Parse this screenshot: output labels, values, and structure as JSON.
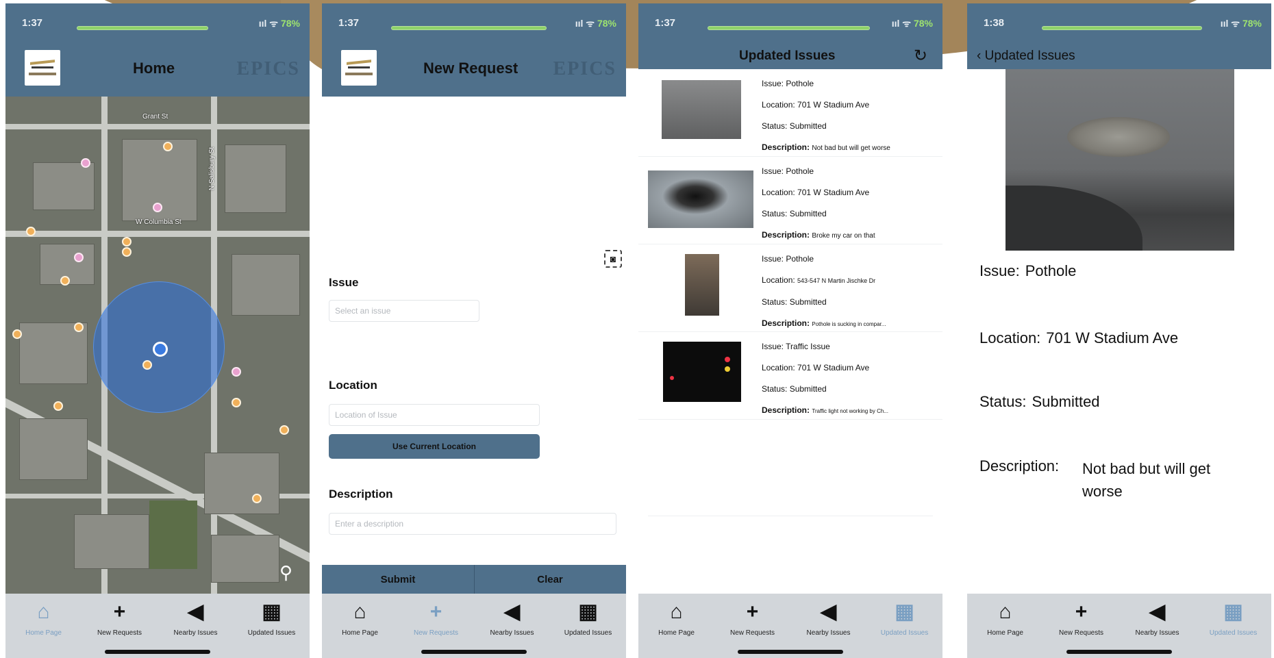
{
  "status": {
    "time_1": "1:37",
    "time_2": "1:37",
    "time_3": "1:37",
    "time_4": "1:38",
    "signal": "ııl ᯤ",
    "battery": "78%"
  },
  "brand": {
    "epics": "EPICS"
  },
  "screens": {
    "home": {
      "title": "Home"
    },
    "new_request": {
      "title": "New Request",
      "issue_label": "Issue",
      "issue_placeholder": "Select an issue",
      "location_label": "Location",
      "location_placeholder": "Location of Issue",
      "use_location_button": "Use Current Location",
      "description_label": "Description",
      "description_placeholder": "Enter a description",
      "submit": "Submit",
      "clear": "Clear"
    },
    "updated": {
      "title": "Updated Issues",
      "issues": [
        {
          "issue": "Pothole",
          "location": "701 W Stadium Ave",
          "status": "Submitted",
          "description": "Not bad but will get worse"
        },
        {
          "issue": "Pothole",
          "location": "701 W Stadium Ave",
          "status": "Submitted",
          "description": "Broke my car on that"
        },
        {
          "issue": "Pothole",
          "location": "543-547 N Martin Jischke Dr",
          "status": "Submitted",
          "description": "Pothole is sucking in compar..."
        },
        {
          "issue": "Traffic Issue",
          "location": "701 W Stadium Ave",
          "status": "Submitted",
          "description": "Traffic light not working by Ch..."
        }
      ]
    },
    "detail": {
      "back": "Updated Issues",
      "issue_label": "Issue:",
      "issue": "Pothole",
      "location_label": "Location:",
      "location": "701 W Stadium Ave",
      "status_label": "Status:",
      "status": "Submitted",
      "description_label": "Description:",
      "description": "Not bad but will get worse"
    }
  },
  "field_labels": {
    "issue": "Issue:",
    "location": "Location:",
    "status": "Status:",
    "description": "Description:"
  },
  "map": {
    "street_1": "Grant St",
    "street_2": "W Columbia St",
    "street_3": "N Salisbury St"
  },
  "tabs": [
    {
      "label": "Home Page",
      "icon": "house-icon"
    },
    {
      "label": "New Requests",
      "icon": "plus-icon"
    },
    {
      "label": "Nearby Issues",
      "icon": "location-arrow-icon"
    },
    {
      "label": "Updated Issues",
      "icon": "calculator-icon"
    }
  ],
  "colors": {
    "header": "#4f708b",
    "tab_active": "#7a9fc2",
    "tabbar": "#d2d6da",
    "accent_gold": "#a3855a"
  }
}
